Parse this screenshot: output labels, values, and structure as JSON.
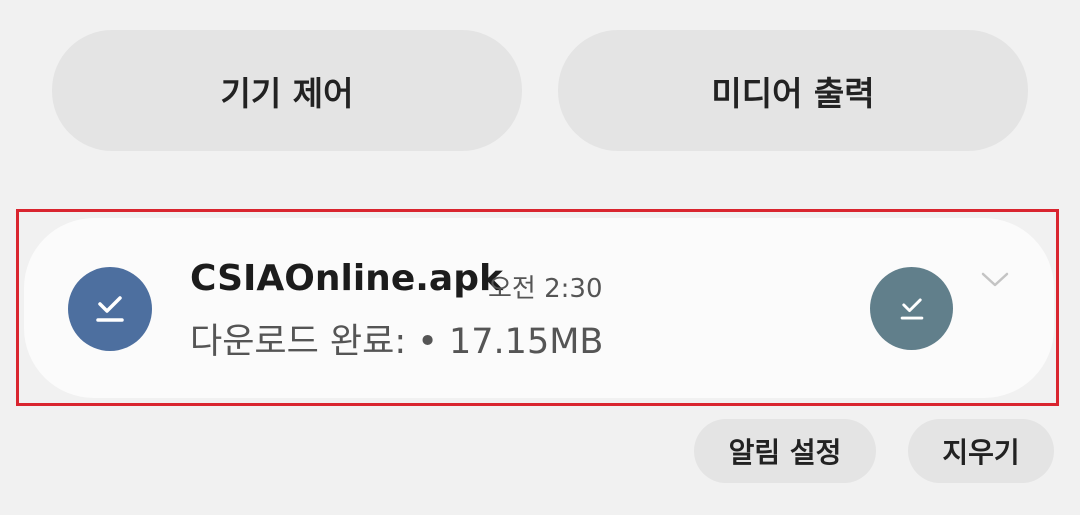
{
  "quick_buttons": {
    "device_control": "기기 제어",
    "media_output": "미디어 출력"
  },
  "notification": {
    "title": "CSIAOnline.apk",
    "time": "오전 2:30",
    "status": "다운로드 완료: • 17.15MB",
    "app_icon": "download-done-icon",
    "large_icon": "download-done-icon",
    "expand_icon": "chevron-down-icon"
  },
  "actions": {
    "notification_settings": "알림 설정",
    "clear": "지우기"
  },
  "colors": {
    "app_icon_bg": "#4d6f9f",
    "large_icon_bg": "#617f8b",
    "highlight": "#d9252f"
  }
}
